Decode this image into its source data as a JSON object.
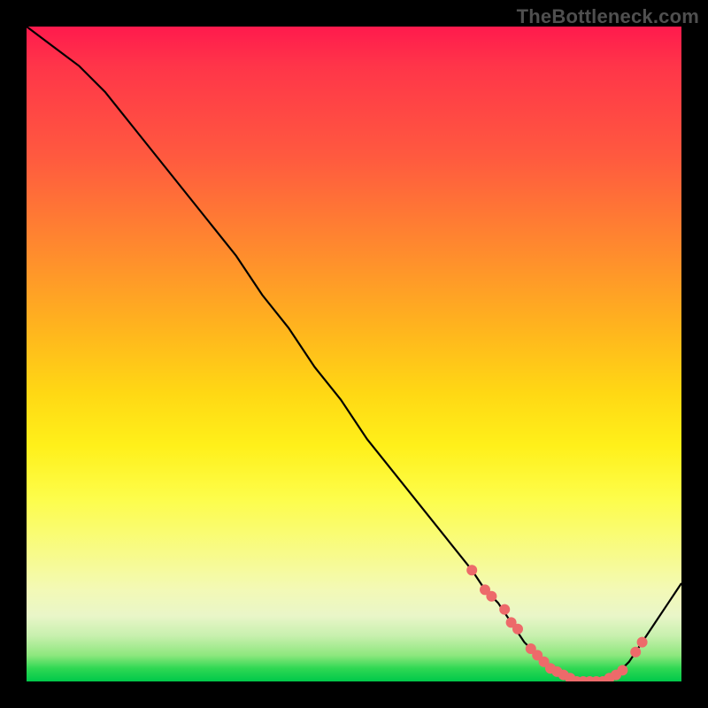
{
  "watermark": "TheBottleneck.com",
  "colors": {
    "curve_stroke": "#000000",
    "dot_fill": "#ed6a6a",
    "dot_stroke": "#ed6a6a"
  },
  "chart_data": {
    "type": "line",
    "title": "",
    "xlabel": "",
    "ylabel": "",
    "xlim": [
      0,
      100
    ],
    "ylim": [
      0,
      100
    ],
    "series": [
      {
        "name": "bottleneck-curve",
        "x": [
          0,
          4,
          8,
          12,
          16,
          20,
          24,
          28,
          32,
          36,
          40,
          44,
          48,
          52,
          56,
          60,
          64,
          68,
          70,
          72,
          74,
          76,
          78,
          80,
          82,
          84,
          86,
          88,
          90,
          92,
          94,
          96,
          98,
          100
        ],
        "y": [
          100,
          97,
          94,
          90,
          85,
          80,
          75,
          70,
          65,
          59,
          54,
          48,
          43,
          37,
          32,
          27,
          22,
          17,
          14,
          12,
          9,
          6,
          4,
          2,
          1,
          0,
          0,
          0,
          1,
          3,
          6,
          9,
          12,
          15
        ]
      }
    ],
    "markers": {
      "name": "valley-dots",
      "x": [
        68,
        70,
        71,
        73,
        74,
        75,
        77,
        78,
        79,
        80,
        81,
        82,
        83,
        84,
        85,
        86,
        87,
        88,
        89,
        90,
        91,
        93,
        94
      ],
      "y": [
        17,
        14,
        13,
        11,
        9,
        8,
        5,
        4,
        3,
        2,
        1.5,
        1,
        0.5,
        0,
        0,
        0,
        0,
        0,
        0.5,
        1,
        1.7,
        4.5,
        6
      ]
    }
  }
}
